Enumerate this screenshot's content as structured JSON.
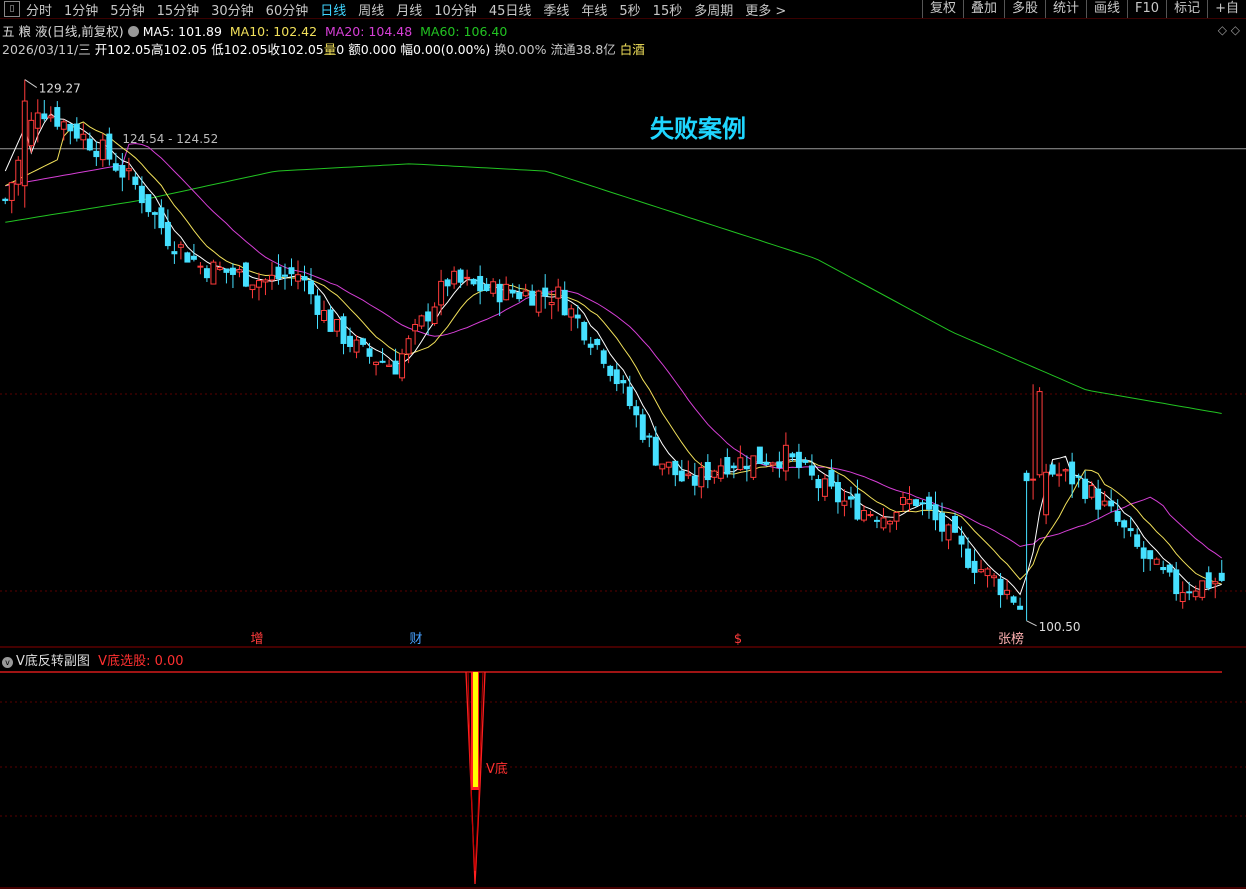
{
  "toolbar": {
    "back_icon": "back-square-icon",
    "timeframes": [
      "分时",
      "1分钟",
      "5分钟",
      "15分钟",
      "30分钟",
      "60分钟",
      "日线",
      "周线",
      "月线",
      "10分钟",
      "45日线",
      "季线",
      "年线",
      "5秒",
      "15秒",
      "多周期",
      "更多 >"
    ],
    "active_timeframe": "日线",
    "right_buttons": [
      "复权",
      "叠加",
      "多股",
      "统计",
      "画线",
      "F10",
      "标记",
      "+自"
    ]
  },
  "header": {
    "stock_name": "五 粮 液",
    "mode": "(日线,前复权)",
    "ma5_label": "MA5: 101.89",
    "ma10_label": "MA10: 102.42",
    "ma20_label": "MA20: 104.48",
    "ma60_label": "MA60: 106.40",
    "date": "2026/03/11/三",
    "open": "开102.05",
    "high": "高102.05",
    "low": "低102.05",
    "close": "收102.05",
    "vol_label": "量",
    "vol_value": "0",
    "amount": "额0.000",
    "change": "幅0.00(0.00%)",
    "turnover": "换0.00%",
    "float_cap": "流通38.8亿",
    "sector": "白酒",
    "corner_icons": "◇ ◇"
  },
  "colors": {
    "up": "#ff3b3b",
    "down": "#46e0ff",
    "ma5": "#ffffff",
    "ma10": "#f1e05a",
    "ma20": "#d63fd6",
    "ma60": "#22c322",
    "annotation_title": "#1fd6ff"
  },
  "chart": {
    "title_text": "失败案例",
    "max_label": "129.27",
    "min_label": "100.50",
    "ref_label": "124.54 - 124.52",
    "event_markers": [
      "增",
      "财",
      "$",
      "张榜"
    ]
  },
  "chart_data": {
    "type": "candlestick",
    "max_price": 129.27,
    "min_price": 100.5,
    "reference_line": 124.53,
    "candles": [],
    "ma60_trend": [
      119.5,
      121,
      123,
      123.5,
      123,
      120,
      117,
      112,
      108,
      106.4
    ]
  },
  "subchart": {
    "title": "V底反转副图",
    "indicator_label": "V底选股: 0.00",
    "signal_label": "V底"
  }
}
